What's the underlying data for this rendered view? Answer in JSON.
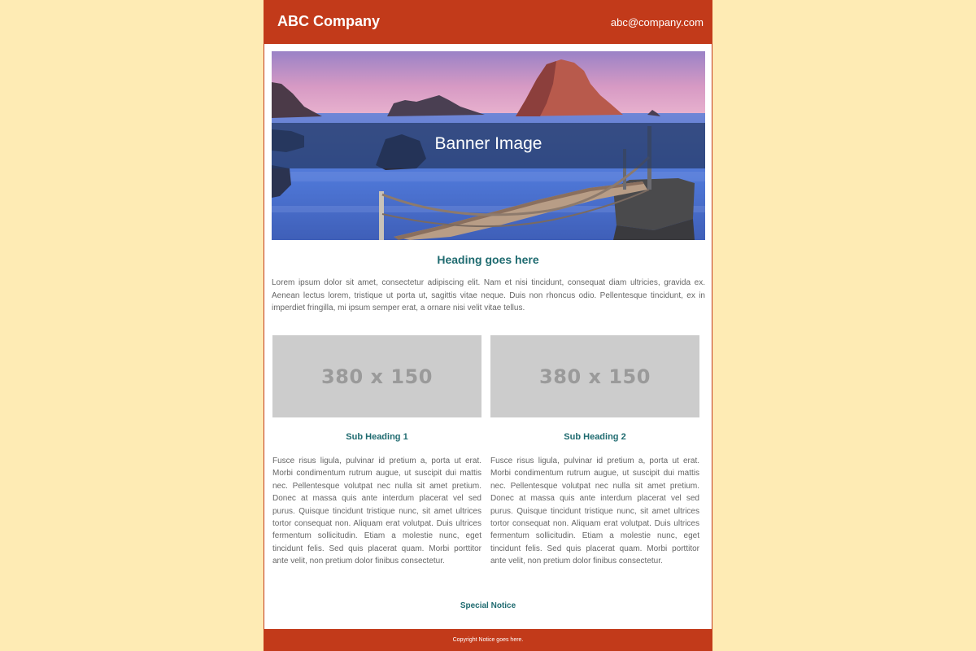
{
  "header": {
    "brand": "ABC Company",
    "email": "abc@company.com"
  },
  "banner": {
    "label": "Banner Image"
  },
  "main": {
    "heading": "Heading goes here",
    "intro": "Lorem ipsum dolor sit amet, consectetur adipiscing elit. Nam et nisi tincidunt, consequat diam ultricies, gravida ex. Aenean lectus lorem, tristique ut porta ut, sagittis vitae neque. Duis non rhoncus odio. Pellentesque tincidunt, ex in imperdiet fringilla, mi ipsum semper erat, a ornare nisi velit vitae tellus."
  },
  "columns": [
    {
      "placeholder": "380 x 150",
      "subheading": "Sub Heading 1",
      "text": "Fusce risus ligula, pulvinar id pretium a, porta ut erat. Morbi condimentum rutrum augue, ut suscipit dui mattis nec. Pellentesque volutpat nec nulla sit amet pretium. Donec at massa quis ante interdum placerat vel sed purus. Quisque tincidunt tristique nunc, sit amet ultrices tortor consequat non. Aliquam erat volutpat. Duis ultrices fermentum sollicitudin. Etiam a molestie nunc, eget tincidunt felis. Sed quis placerat quam. Morbi porttitor ante velit, non pretium dolor finibus consectetur."
    },
    {
      "placeholder": "380 x 150",
      "subheading": "Sub Heading 2",
      "text": "Fusce risus ligula, pulvinar id pretium a, porta ut erat. Morbi condimentum rutrum augue, ut suscipit dui mattis nec. Pellentesque volutpat nec nulla sit amet pretium. Donec at massa quis ante interdum placerat vel sed purus. Quisque tincidunt tristique nunc, sit amet ultrices tortor consequat non. Aliquam erat volutpat. Duis ultrices fermentum sollicitudin. Etiam a molestie nunc, eget tincidunt felis. Sed quis placerat quam. Morbi porttitor ante velit, non pretium dolor finibus consectetur."
    }
  ],
  "notice": "Special Notice",
  "footer": {
    "copyright": "Copyright Notice goes here."
  },
  "colors": {
    "page_background": "#feebb4",
    "brand_red": "#c23a1a",
    "heading_teal": "#1f6b70",
    "body_text": "#666666",
    "placeholder_gray": "#cccccc"
  }
}
